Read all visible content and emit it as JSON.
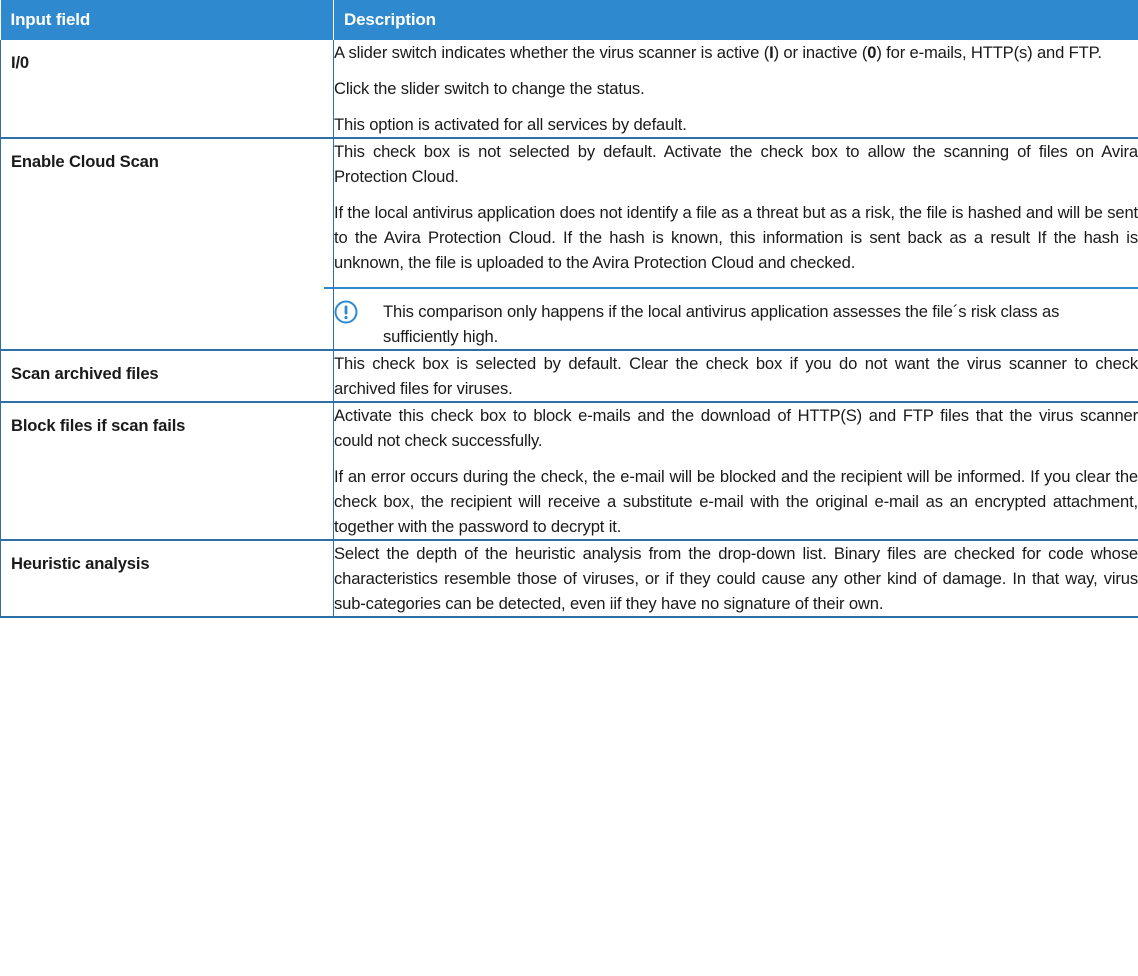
{
  "table": {
    "headers": {
      "field": "Input field",
      "description": "Description"
    },
    "rows": [
      {
        "field": "I/0",
        "paragraphs": [
          {
            "segments": [
              {
                "text": "A slider switch indicates whether the virus scanner is active ("
              },
              {
                "text": "I",
                "bold": true
              },
              {
                "text": ") or inactive ("
              },
              {
                "text": "0",
                "bold": true
              },
              {
                "text": ") for e-mails, HTTP(s) and FTP."
              }
            ]
          },
          {
            "segments": [
              {
                "text": "Click the slider switch to change the status."
              }
            ]
          },
          {
            "segments": [
              {
                "text": "This option is activated for all services by default."
              }
            ]
          }
        ]
      },
      {
        "field": "Enable Cloud Scan",
        "paragraphs": [
          {
            "segments": [
              {
                "text": "This check box is not selected by default. Activate the check box to allow the scanning of files on Avira Protection Cloud."
              }
            ]
          },
          {
            "segments": [
              {
                "text": "If the local antivirus application does not identify a file as a threat but as a risk, the file is hashed and will be sent to the Avira Protection Cloud. If the hash is known, this information is sent back as a result If the hash is unknown, the file is uploaded to the Avira Protection Cloud and checked."
              }
            ]
          }
        ],
        "note": {
          "icon": "exclamation-circle-icon",
          "text": "This comparison only happens if the local antivirus application assesses the file´s risk class as sufficiently high."
        }
      },
      {
        "field": "Scan archived files",
        "paragraphs": [
          {
            "segments": [
              {
                "text": "This check box is selected by default. Clear the check box if you do not want the virus scanner to check archived files for viruses."
              }
            ]
          }
        ]
      },
      {
        "field": "Block files if scan fails",
        "paragraphs": [
          {
            "segments": [
              {
                "text": "Activate this check box to block e-mails and the download of HTTP(S) and FTP files that the virus scanner could not check successfully."
              }
            ]
          },
          {
            "segments": [
              {
                "text": "If an error occurs during the check, the e-mail will be blocked and the recipient will be informed. If you clear the check box, the recipient will receive a substitute e-mail with the original e-mail as an encrypted attachment, together with the password to decrypt it."
              }
            ]
          }
        ]
      },
      {
        "field": "Heuristic analysis",
        "paragraphs": [
          {
            "segments": [
              {
                "text": "Select the depth of the heuristic analysis from the drop-down list. Binary files are checked for code whose characteristics resemble those of viruses, or if they could cause any other kind of damage. In that way, virus sub-categories can be detected, even iif they have no signature of their own."
              }
            ]
          }
        ]
      }
    ]
  },
  "colors": {
    "header_bg": "#2f89cf",
    "border": "#2f6fa8",
    "note_icon": "#2f89cf"
  }
}
